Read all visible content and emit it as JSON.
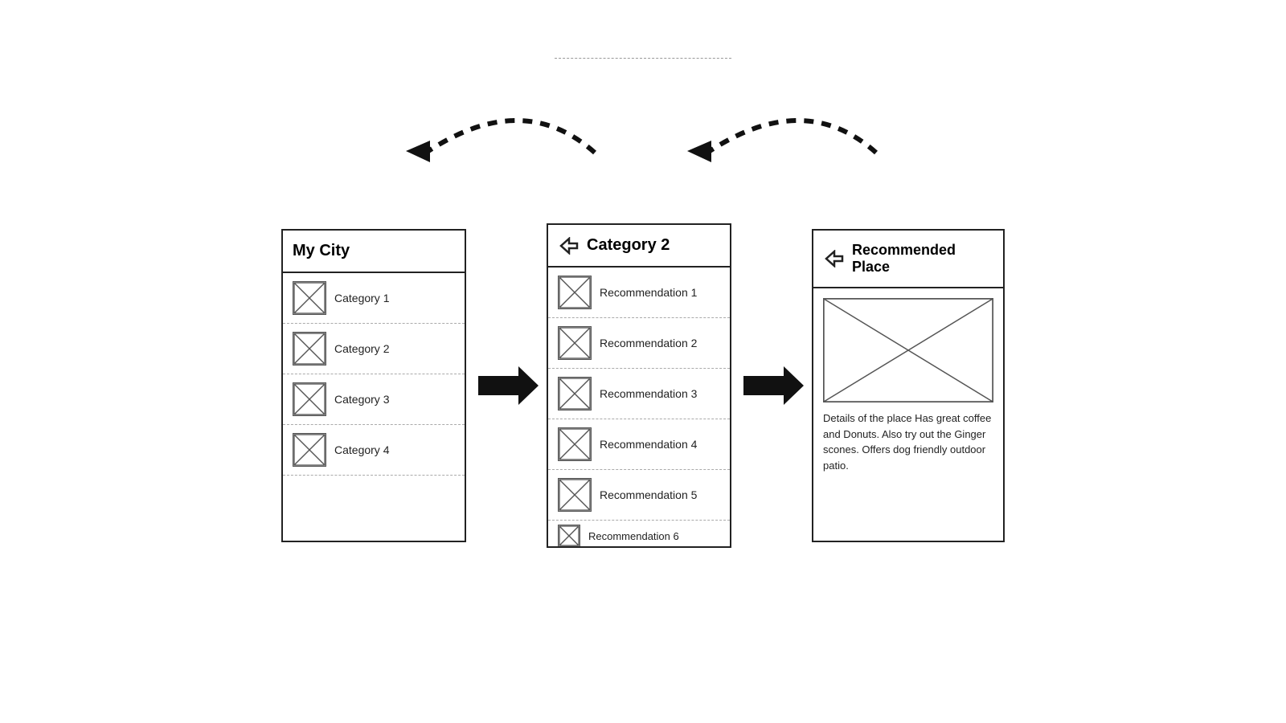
{
  "separator": {
    "visible": true
  },
  "panel1": {
    "title": "My City",
    "items": [
      {
        "label": "Category 1"
      },
      {
        "label": "Category 2"
      },
      {
        "label": "Category 3"
      },
      {
        "label": "Category 4"
      }
    ]
  },
  "panel2": {
    "title": "Category 2",
    "has_back": true,
    "items": [
      {
        "label": "Recommendation 1"
      },
      {
        "label": "Recommendation 2"
      },
      {
        "label": "Recommendation 3"
      },
      {
        "label": "Recommendation 4"
      },
      {
        "label": "Recommendation 5"
      },
      {
        "label": "Recommendation 6"
      }
    ]
  },
  "panel3": {
    "title": "Recommended Place",
    "has_back": true,
    "detail_text": "Details of the place Has great coffee and Donuts. Also try out the Ginger scones. Offers dog friendly outdoor patio."
  },
  "arrows": {
    "forward_label": "→",
    "back_label": "←"
  }
}
